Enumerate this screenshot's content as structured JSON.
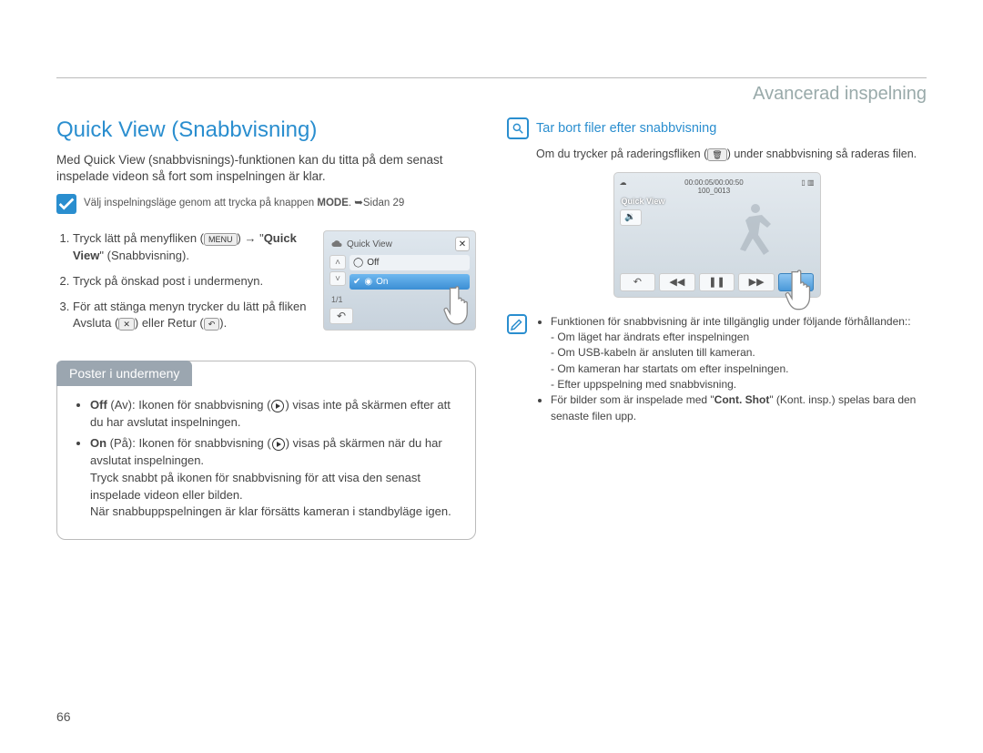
{
  "header": {
    "breadcrumb": "Avancerad inspelning"
  },
  "left": {
    "title": "Quick View (Snabbvisning)",
    "intro": "Med Quick View (snabbvisnings)-funktionen kan du titta på dem senast inspelade videon så fort som inspelningen är klar.",
    "note_pre": "Välj inspelningsläge genom att trycka på knappen ",
    "note_mode": "MODE",
    "note_post": ". ➥Sidan 29",
    "step1_pre": "Tryck lätt på menyfliken (",
    "step1_menu": "MENU",
    "step1_mid": ") → \"",
    "step1_qv": "Quick View",
    "step1_post": "\" (Snabbvisning).",
    "step2": "Tryck på önskad post i undermenyn.",
    "step3_pre": "För att stänga menyn trycker du lätt på fliken Avsluta (",
    "step3_x": "✕",
    "step3_mid": ") eller Retur (",
    "step3_ret": "↶",
    "step3_post": ").",
    "menu": {
      "title": "Quick View",
      "off": "Off",
      "on": "On",
      "page": "1/1"
    },
    "sub_header": "Poster i undermeny",
    "off_label": "Off",
    "off_paren": " (Av): Ikonen för snabbvisning (",
    "off_rest": ") visas inte på skärmen efter att du har avslutat inspelningen.",
    "on_label": "On",
    "on_paren": " (På): Ikonen för snabbvisning (",
    "on_rest1": ") visas på skärmen när du har avslutat inspelningen.",
    "on_rest2": "Tryck snabbt på ikonen för snabbvisning för att visa den senast inspelade videon eller bilden.",
    "on_rest3": "När snabbuppspelningen är klar försätts kameran i standbyläge igen."
  },
  "right": {
    "title": "Tar bort filer efter snabbvisning",
    "desc_pre": "Om du trycker på raderingsfliken (",
    "desc_post": ") under snabbvisning så raderas filen.",
    "screen": {
      "time": "00:00:05/00:00:50",
      "count": "100_0013",
      "qv": "Quick View"
    },
    "note_intro": "Funktionen för snabbvisning är inte tillgänglig under följande förhållanden::",
    "note_items": [
      "Om läget har ändrats efter inspelningen",
      "Om USB-kabeln är ansluten till kameran.",
      "Om kameran har startats om efter inspelningen.",
      "Efter uppspelning med snabbvisning."
    ],
    "note2_pre": "För bilder som är inspelade med \"",
    "note2_bold": "Cont. Shot",
    "note2_post": "\" (Kont. insp.) spelas bara den senaste filen upp."
  },
  "page": "66"
}
